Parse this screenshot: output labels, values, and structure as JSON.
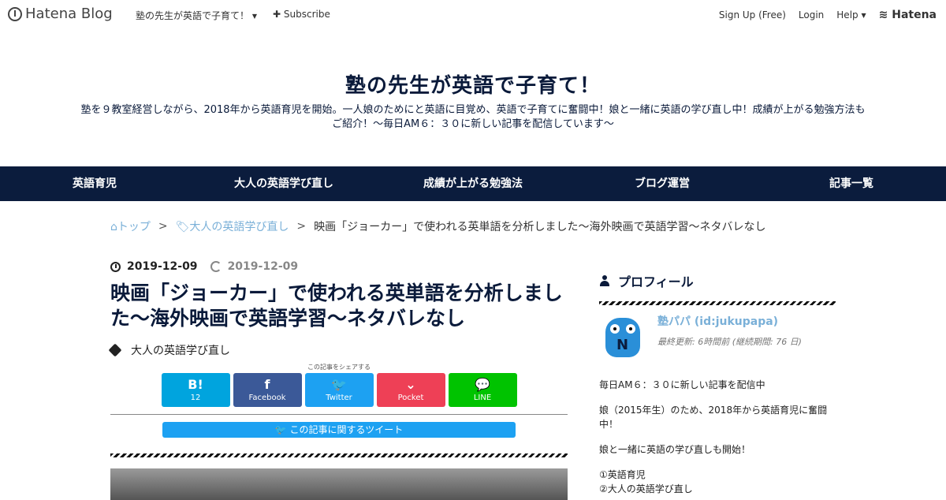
{
  "topbar": {
    "logo_text": "Hatena Blog",
    "blog_name": "塾の先生が英語で子育て！",
    "subscribe": "Subscribe",
    "signup": "Sign Up (Free)",
    "login": "Login",
    "help": "Help",
    "hatena": "Hatena"
  },
  "header": {
    "title": "塾の先生が英語で子育て！",
    "description": "塾を９教室経営しながら、2018年から英語育児を開始。一人娘のためにと英語に目覚め、英語で子育てに奮闘中！娘と一緒に英語の学び直し中！成績が上がる勉強方法もご紹介！～毎日AM６：３０に新しい記事を配信しています～"
  },
  "nav": {
    "items": [
      "英語育児",
      "大人の英語学び直し",
      "成績が上がる勉強法",
      "ブログ運営",
      "記事一覧"
    ]
  },
  "breadcrumb": {
    "top": "トップ",
    "category": "大人の英語学び直し",
    "sep": ">",
    "current": "映画「ジョーカー」で使われる英単語を分析しました～海外映画で英語学習～ネタバレなし"
  },
  "entry": {
    "published": "2019-12-09",
    "updated": "2019-12-09",
    "title": "映画「ジョーカー」で使われる英単語を分析しました～海外映画で英語学習～ネタバレなし",
    "category": "大人の英語学び直し",
    "share_caption": "この記事をシェアする",
    "share": [
      {
        "label": "12",
        "glyph": "B!",
        "color": "#00a4de"
      },
      {
        "label": "Facebook",
        "glyph": "f",
        "color": "#3b5998"
      },
      {
        "label": "Twitter",
        "glyph": "🐦",
        "color": "#1da1f2"
      },
      {
        "label": "Pocket",
        "glyph": "⌄",
        "color": "#ee4056"
      },
      {
        "label": "LINE",
        "glyph": "💬",
        "color": "#00c300"
      }
    ],
    "tweet_label": "この記事に関するツイート"
  },
  "sidebar": {
    "profile_heading": "プロフィール",
    "name": "塾パパ (id:jukupapa)",
    "updated": "最終更新: 6時間前 (継続期間: 76 日)",
    "p1": "毎日AM６：３０に新しい記事を配信中",
    "p2": "娘（2015年生）のため、2018年から英語育児に奮闘中！",
    "p3": "娘と一緒に英語の学び直しも開始！",
    "list1": "①英語育児",
    "list2": "②大人の英語学び直し"
  }
}
